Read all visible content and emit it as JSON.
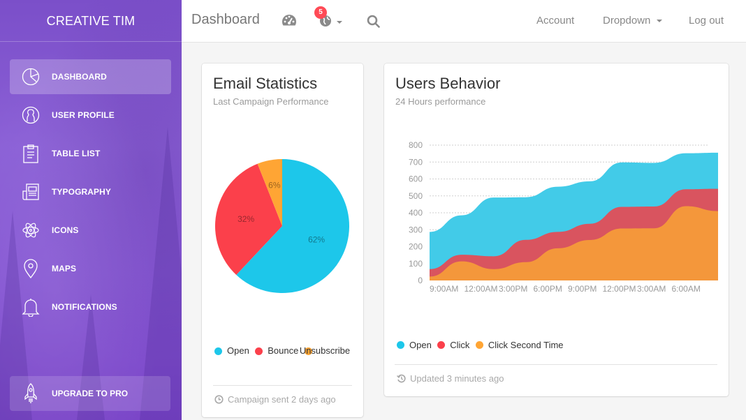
{
  "sidebar": {
    "brand": "CREATIVE TIM",
    "items": [
      {
        "label": "DASHBOARD",
        "icon": "pie-chart-icon",
        "active": true
      },
      {
        "label": "USER PROFILE",
        "icon": "user-icon",
        "active": false
      },
      {
        "label": "TABLE LIST",
        "icon": "clipboard-icon",
        "active": false
      },
      {
        "label": "TYPOGRAPHY",
        "icon": "news-icon",
        "active": false
      },
      {
        "label": "ICONS",
        "icon": "atom-icon",
        "active": false
      },
      {
        "label": "MAPS",
        "icon": "map-pin-icon",
        "active": false
      },
      {
        "label": "NOTIFICATIONS",
        "icon": "bell-icon",
        "active": false
      }
    ],
    "upgrade": {
      "label": "UPGRADE TO PRO",
      "icon": "rocket-icon"
    }
  },
  "navbar": {
    "title": "Dashboard",
    "icons": [
      "dashboard-gauge-icon",
      "globe-icon",
      "search-icon"
    ],
    "notification_count": "5",
    "links": {
      "account": "Account",
      "dropdown": "Dropdown",
      "logout": "Log out"
    }
  },
  "colors": {
    "open": "#1dc7ea",
    "bounce": "#fb404b",
    "unsubscribe": "#ffa534",
    "click": "#d9545f",
    "click_second": "#f4973b",
    "open_area": "#42cbe8"
  },
  "email_card": {
    "title": "Email Statistics",
    "category": "Last Campaign Performance",
    "legend": [
      "Open",
      "Bounce",
      "Unsubscribe"
    ],
    "footer": "Campaign sent 2 days ago",
    "footer_icon": "clock-icon"
  },
  "users_card": {
    "title": "Users Behavior",
    "category": "24 Hours performance",
    "legend": [
      "Open",
      "Click",
      "Click Second Time"
    ],
    "footer": "Updated 3 minutes ago",
    "footer_icon": "history-icon"
  },
  "chart_data": [
    {
      "type": "pie",
      "title": "Email Statistics",
      "categories": [
        "Open",
        "Bounce",
        "Unsubscribe"
      ],
      "values": [
        62,
        32,
        6
      ],
      "labels": [
        "62%",
        "32%",
        "6%"
      ]
    },
    {
      "type": "area",
      "title": "Users Behavior",
      "x": [
        "9:00AM",
        "12:00AM",
        "3:00PM",
        "6:00PM",
        "9:00PM",
        "12:00PM",
        "3:00AM",
        "6:00AM"
      ],
      "ylim": [
        0,
        800
      ],
      "yticks": [
        0,
        100,
        200,
        300,
        400,
        500,
        600,
        700,
        800
      ],
      "grid": true,
      "legend": "bottom-left",
      "series": [
        {
          "name": "Open",
          "values": [
            287,
            385,
            490,
            492,
            554,
            586,
            698,
            695,
            752,
            755
          ]
        },
        {
          "name": "Click",
          "values": [
            67,
            152,
            143,
            240,
            287,
            335,
            435,
            437,
            539,
            542
          ]
        },
        {
          "name": "Click Second Time",
          "values": [
            23,
            113,
            67,
            108,
            190,
            239,
            307,
            308,
            439,
            410
          ]
        }
      ]
    }
  ]
}
